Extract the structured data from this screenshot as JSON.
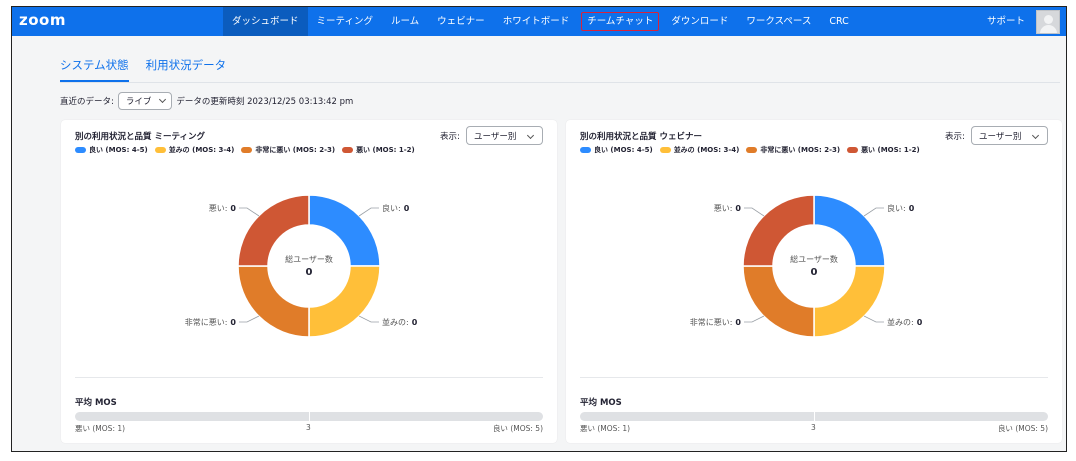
{
  "app": {
    "logo": "zoom"
  },
  "nav": {
    "items": [
      {
        "label": "ダッシュボード",
        "name": "nav-dashboard",
        "active": true
      },
      {
        "label": "ミーティング",
        "name": "nav-meetings"
      },
      {
        "label": "ルーム",
        "name": "nav-rooms"
      },
      {
        "label": "ウェビナー",
        "name": "nav-webinars"
      },
      {
        "label": "ホワイトボード",
        "name": "nav-whiteboard"
      },
      {
        "label": "チームチャット",
        "name": "nav-team-chat",
        "highlighted": true
      },
      {
        "label": "ダウンロード",
        "name": "nav-download"
      },
      {
        "label": "ワークスペース",
        "name": "nav-workspaces"
      },
      {
        "label": "CRC",
        "name": "nav-crc"
      }
    ],
    "support": "サポート"
  },
  "tabs": [
    {
      "label": "システム状態",
      "active": true
    },
    {
      "label": "利用状況データ"
    }
  ],
  "filter": {
    "label": "直近のデータ:",
    "select_value": "ライブ",
    "updated": "データの更新時刻 2023/12/25 03:13:42 pm"
  },
  "colors": {
    "brand": "#0e71eb",
    "good": "#2d8cff",
    "fair": "#ffbf39",
    "poor": "#e07c29",
    "bad": "#cf5734"
  },
  "cards": [
    {
      "title": "別の利用状況と品質 ミーティング",
      "view_label": "表示:",
      "view_value": "ユーザー別",
      "legend": [
        "良い (MOS: 4-5)",
        "並みの (MOS: 3-4)",
        "非常に悪い (MOS: 2-3)",
        "悪い (MOS: 1-2)"
      ],
      "center_label": "総ユーザー数",
      "center_value": "0",
      "slices": [
        {
          "label": "良い:",
          "value": "0"
        },
        {
          "label": "並みの:",
          "value": "0"
        },
        {
          "label": "非常に悪い:",
          "value": "0"
        },
        {
          "label": "悪い:",
          "value": "0"
        }
      ],
      "mos_title": "平均 MOS",
      "mos_left": "悪い (MOS: 1)",
      "mos_mid": "3",
      "mos_right": "良い (MOS: 5)"
    },
    {
      "title": "別の利用状況と品質 ウェビナー",
      "view_label": "表示:",
      "view_value": "ユーザー別",
      "legend": [
        "良い (MOS: 4-5)",
        "並みの (MOS: 3-4)",
        "非常に悪い (MOS: 2-3)",
        "悪い (MOS: 1-2)"
      ],
      "center_label": "総ユーザー数",
      "center_value": "0",
      "slices": [
        {
          "label": "良い:",
          "value": "0"
        },
        {
          "label": "並みの:",
          "value": "0"
        },
        {
          "label": "非常に悪い:",
          "value": "0"
        },
        {
          "label": "悪い:",
          "value": "0"
        }
      ],
      "mos_title": "平均 MOS",
      "mos_left": "悪い (MOS: 1)",
      "mos_mid": "3",
      "mos_right": "良い (MOS: 5)"
    }
  ]
}
